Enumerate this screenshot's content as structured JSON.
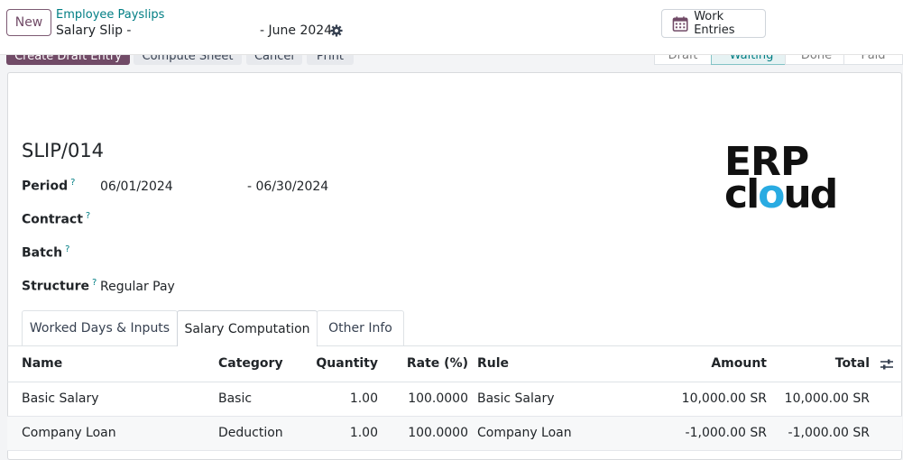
{
  "header": {
    "new_label": "New",
    "breadcrumb_parent": "Employee Payslips",
    "breadcrumb_current": "Salary Slip -",
    "breadcrumb_date": "- June 2024",
    "work_entries_label": "Work Entries"
  },
  "actions": {
    "primary": "Create Draft Entry",
    "compute": "Compute Sheet",
    "cancel": "Cancel",
    "print": "Print"
  },
  "statusbar": [
    "Draft",
    "Waiting",
    "Done",
    "Paid"
  ],
  "form": {
    "title": "SLIP/014",
    "period_label": "Period",
    "period_from": "06/01/2024",
    "period_to": "- 06/30/2024",
    "contract_label": "Contract",
    "batch_label": "Batch",
    "structure_label": "Structure",
    "structure_value": "Regular Pay",
    "help_mark": "?"
  },
  "logo": {
    "top": "ERP",
    "bottom_a": "cl",
    "bottom_q": "o",
    "bottom_b": "ud"
  },
  "tabs": [
    "Worked Days & Inputs",
    "Salary Computation",
    "Other Info"
  ],
  "table": {
    "columns": [
      "Name",
      "Category",
      "Quantity",
      "Rate (%)",
      "Rule",
      "Amount",
      "Total"
    ],
    "rows": [
      [
        "Basic Salary",
        "Basic",
        "1.00",
        "100.0000",
        "Basic Salary",
        "10,000.00 SR",
        "10,000.00 SR"
      ],
      [
        "Company Loan",
        "Deduction",
        "1.00",
        "100.0000",
        "Company Loan",
        "-1,000.00 SR",
        "-1,000.00 SR"
      ]
    ]
  },
  "colors": {
    "primary": "#714b67",
    "link": "#017e84",
    "logo_accent": "#29abe2"
  }
}
